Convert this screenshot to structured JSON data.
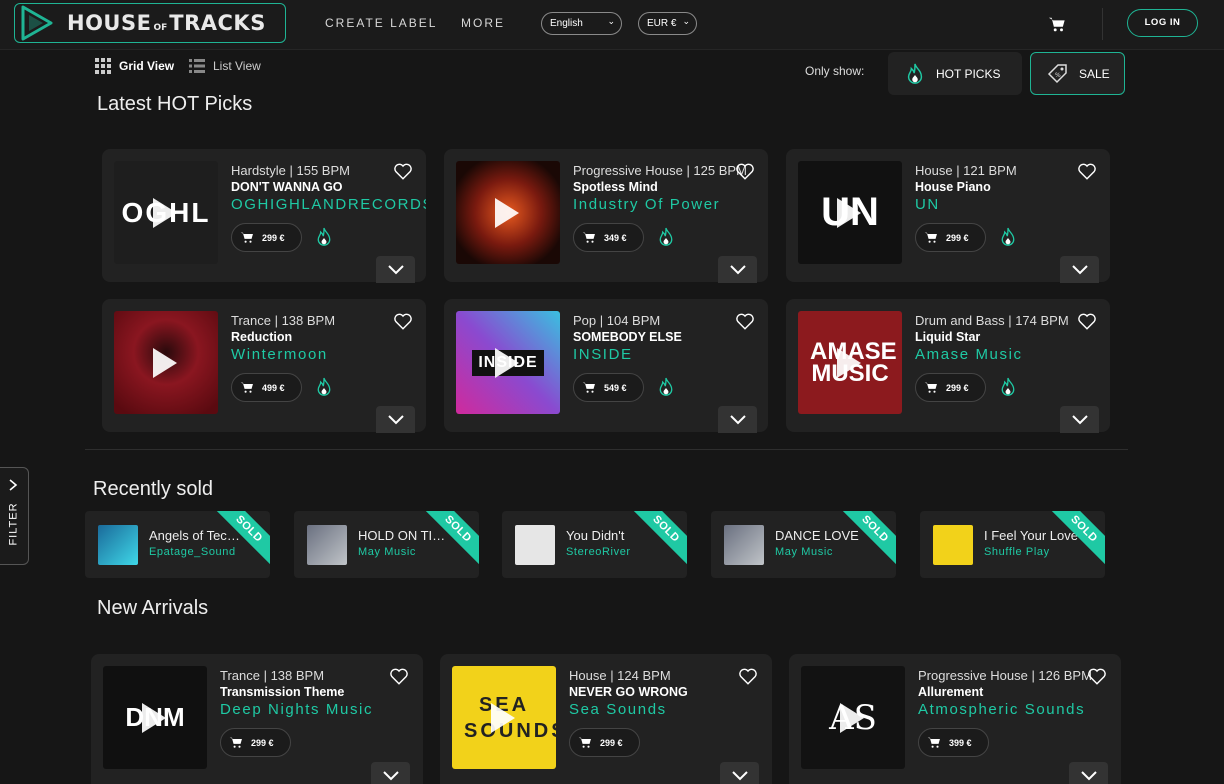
{
  "header": {
    "logo_text_1": "HOUSE",
    "logo_text_of": "OF",
    "logo_text_2": "TRACKS",
    "nav": [
      "CREATE LABEL",
      "MORE"
    ],
    "language": "English",
    "currency": "EUR €",
    "login": "LOG IN"
  },
  "view": {
    "grid": "Grid View",
    "list": "List View"
  },
  "filters": {
    "label": "Only show:",
    "hot": "HOT PICKS",
    "sale": "SALE"
  },
  "sections": {
    "hot": "Latest HOT Picks",
    "sold": "Recently sold",
    "new": "New Arrivals"
  },
  "hot_picks": [
    {
      "meta": "Hardstyle | 155 BPM",
      "title": "DON'T WANNA GO",
      "artist": "OGHIGHLANDRECORDS",
      "price": "299 €",
      "cover_color": "#1e1e1e",
      "cover_text": "OGHL"
    },
    {
      "meta": "Progressive House | 125 BPM",
      "title": "Spotless Mind",
      "artist": "Industry Of Power",
      "price": "349 €",
      "cover_color": "#3a1410",
      "cover_text": ""
    },
    {
      "meta": "House | 121 BPM",
      "title": "House Piano",
      "artist": "UN",
      "price": "299 €",
      "cover_color": "#111111",
      "cover_text": "UN"
    },
    {
      "meta": "Trance | 138 BPM",
      "title": "Reduction",
      "artist": "Wintermoon",
      "price": "499 €",
      "cover_color": "#8a1620",
      "cover_text": ""
    },
    {
      "meta": "Pop | 104 BPM",
      "title": "SOMEBODY ELSE",
      "artist": "INSIDE",
      "price": "549 €",
      "cover_color": "#b03ab0",
      "cover_text": "INSIDE"
    },
    {
      "meta": "Drum and Bass | 174 BPM",
      "title": "Liquid Star",
      "artist": "Amase Music",
      "price": "299 €",
      "cover_color": "#8c1a1e",
      "cover_text": "AMASE MUSIC"
    }
  ],
  "recently_sold": [
    {
      "title": "Angels of Techno",
      "artist": "Epatage_Sound",
      "badge": "SOLD",
      "thumb_color": "#3fb8d8"
    },
    {
      "title": "HOLD ON TIGHT",
      "artist": "May Music",
      "badge": "SOLD",
      "thumb_color": "#9aa0a8"
    },
    {
      "title": "You Didn't",
      "artist": "StereoRiver",
      "badge": "SOLD",
      "thumb_color": "#e6e6e6"
    },
    {
      "title": "DANCE LOVE",
      "artist": "May Music",
      "badge": "SOLD",
      "thumb_color": "#9aa0a8"
    },
    {
      "title": "I Feel Your Love",
      "artist": "Shuffle Play",
      "badge": "SOLD",
      "thumb_color": "#f2d21a"
    }
  ],
  "new_arrivals": [
    {
      "meta": "Trance | 138 BPM",
      "title": "Transmission Theme",
      "artist": "Deep Nights Music",
      "price": "299 €",
      "cover_color": "#101010",
      "cover_text": "DNM"
    },
    {
      "meta": "House | 124 BPM",
      "title": "NEVER GO WRONG",
      "artist": "Sea Sounds",
      "price": "299 €",
      "cover_color": "#f2d21a",
      "cover_text": "SEA SOUNDS"
    },
    {
      "meta": "Progressive House | 126 BPM",
      "title": "Allurement",
      "artist": "Atmospheric Sounds",
      "price": "399 €",
      "cover_color": "#121212",
      "cover_text": "AS"
    }
  ],
  "filter_tab": "FILTER",
  "colors": {
    "accent": "#1fc9a4",
    "card": "#222222",
    "background": "#161616"
  }
}
